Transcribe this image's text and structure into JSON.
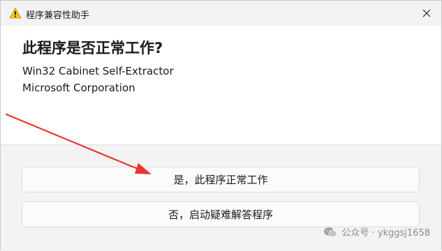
{
  "titlebar": {
    "title": "程序兼容性助手",
    "icon": "warning-icon",
    "close_icon": "close-icon"
  },
  "content": {
    "heading": "此程序是否正常工作?",
    "app_name": "Win32 Cabinet Self-Extractor",
    "publisher": "Microsoft Corporation"
  },
  "options": {
    "yes_label": "是，此程序正常工作",
    "no_label": "否，启动疑难解答程序"
  },
  "watermark": {
    "text": "公众号 · ykggsj1658",
    "icon": "wechat-icon"
  },
  "colors": {
    "warning": "#f5c518",
    "arrow": "#e8362c"
  }
}
